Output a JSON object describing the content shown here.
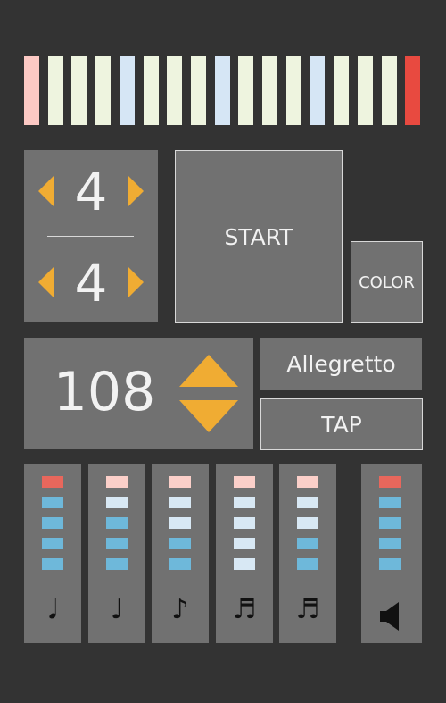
{
  "colors": {
    "background": "#333333",
    "panel": "#717171",
    "accent": "#f0ac33",
    "text": "#f2f2f2",
    "led_red": "#e8675c",
    "led_pink": "#fbcfc9",
    "led_blue": "#6eb8da",
    "led_lightblue": "#d8e8f4"
  },
  "beat_bar": [
    {
      "state": "accent-pink",
      "color": "#fcc9c4"
    },
    {
      "state": "normal",
      "color": "#eef4df"
    },
    {
      "state": "normal",
      "color": "#eef4df"
    },
    {
      "state": "normal",
      "color": "#eef4df"
    },
    {
      "state": "downbeat",
      "color": "#d6e6f5"
    },
    {
      "state": "normal",
      "color": "#eef4df"
    },
    {
      "state": "normal",
      "color": "#eef4df"
    },
    {
      "state": "normal",
      "color": "#eef4df"
    },
    {
      "state": "downbeat",
      "color": "#d6e6f5"
    },
    {
      "state": "normal",
      "color": "#eef4df"
    },
    {
      "state": "normal",
      "color": "#eef4df"
    },
    {
      "state": "normal",
      "color": "#eef4df"
    },
    {
      "state": "downbeat",
      "color": "#d6e6f5"
    },
    {
      "state": "normal",
      "color": "#eef4df"
    },
    {
      "state": "normal",
      "color": "#eef4df"
    },
    {
      "state": "normal",
      "color": "#eef4df"
    },
    {
      "state": "current",
      "color": "#e84a40"
    }
  ],
  "time_signature": {
    "numerator": "4",
    "denominator": "4"
  },
  "buttons": {
    "start": "START",
    "color": "COLOR",
    "tap": "TAP"
  },
  "tempo": {
    "bpm": "108",
    "marking": "Allegretto"
  },
  "channels": [
    {
      "icon": "accent-quarter-note-icon",
      "glyph": "𝅘𝅥",
      "leds": [
        "#e8675c",
        "#6eb8da",
        "#6eb8da",
        "#6eb8da",
        "#6eb8da"
      ]
    },
    {
      "icon": "quarter-note-icon",
      "glyph": "♩",
      "leds": [
        "#fbcfc9",
        "#d8e8f4",
        "#6eb8da",
        "#6eb8da",
        "#6eb8da"
      ]
    },
    {
      "icon": "eighth-note-icon",
      "glyph": "♪",
      "leds": [
        "#fbcfc9",
        "#d8e8f4",
        "#d8e8f4",
        "#6eb8da",
        "#6eb8da"
      ]
    },
    {
      "icon": "triplet-sixteenth-notes-icon",
      "glyph": "♬",
      "leds": [
        "#fbcfc9",
        "#d8e8f4",
        "#d8e8f4",
        "#d8e8f4",
        "#d8e8f4"
      ]
    },
    {
      "icon": "sixteenth-notes-icon",
      "glyph": "♬",
      "leds": [
        "#fbcfc9",
        "#d8e8f4",
        "#d8e8f4",
        "#6eb8da",
        "#6eb8da"
      ]
    }
  ],
  "volume": {
    "icon": "speaker-icon",
    "leds": [
      "#e8675c",
      "#6eb8da",
      "#6eb8da",
      "#6eb8da",
      "#6eb8da"
    ]
  }
}
